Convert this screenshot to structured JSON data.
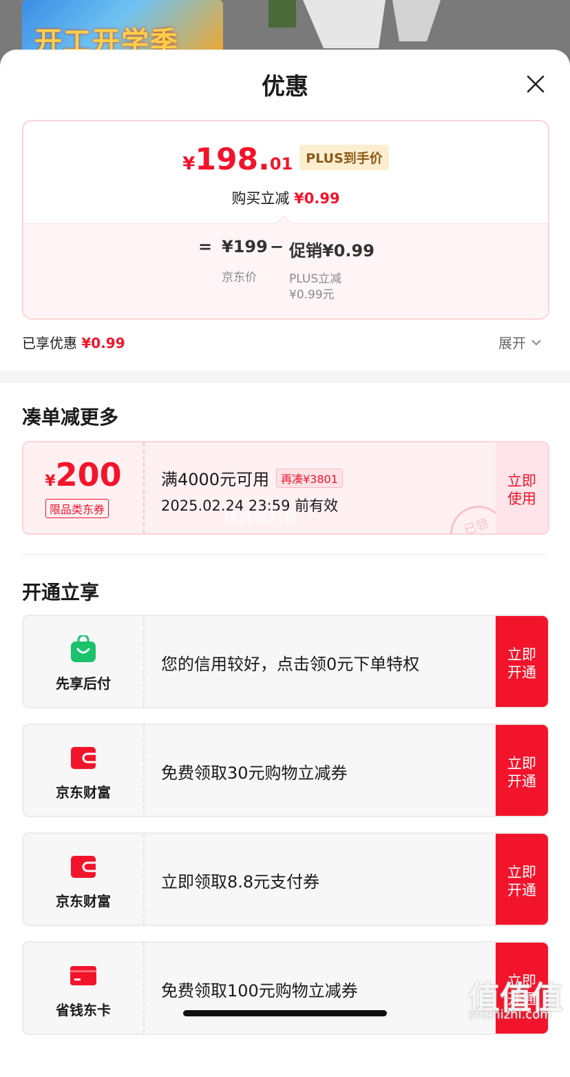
{
  "background": {
    "banner_text": "开工开学季"
  },
  "sheet": {
    "title": "优惠"
  },
  "price_card": {
    "currency": "¥",
    "integer": "198.",
    "decimal": "01",
    "plus_tag": "PLUS到手价",
    "instant_label": "购买立减",
    "instant_value": "¥0.99",
    "formula": {
      "equals": "=",
      "jd_price": "¥199",
      "minus": "−",
      "promo": "促销¥0.99",
      "jd_price_label": "京东价",
      "promo_label_1": "PLUS立减",
      "promo_label_2": "¥0.99元"
    }
  },
  "enjoyed": {
    "label": "已享优惠",
    "value": "¥0.99",
    "expand": "展开"
  },
  "more_section": {
    "title": "凑单减更多",
    "coupon": {
      "currency": "¥",
      "amount": "200",
      "type": "限品类东券",
      "condition": "满4000元可用",
      "extra_tag": "再凑¥3801",
      "validity": "2025.02.24 23:59 前有效",
      "watermark": "精选福利官",
      "stamp": "已领",
      "button_line1": "立即",
      "button_line2": "使用"
    }
  },
  "open_section": {
    "title": "开通立享",
    "items": [
      {
        "name": "先享后付",
        "text": "您的信用较好，点击领0元下单特权",
        "btn1": "立即",
        "btn2": "开通",
        "icon": "shopping-bag-icon",
        "color": "#19c26b"
      },
      {
        "name": "京东财富",
        "text": "免费领取30元购物立减券",
        "btn1": "立即",
        "btn2": "开通",
        "icon": "wallet-icon",
        "color": "#f2142b"
      },
      {
        "name": "京东财富",
        "text": "立即领取8.8元支付券",
        "btn1": "立即",
        "btn2": "开通",
        "icon": "wallet-icon",
        "color": "#f2142b"
      },
      {
        "name": "省钱东卡",
        "text": "免费领取100元购物立减券",
        "btn1": "立即",
        "btn2": "开通",
        "icon": "card-icon",
        "color": "#f2142b"
      }
    ]
  },
  "watermark_site": {
    "logo": "值值值",
    "url": "zhizhizhi.com"
  },
  "colors": {
    "accent": "#f2142b",
    "plus_tag_bg": "#fdeed0",
    "green": "#19c26b"
  }
}
